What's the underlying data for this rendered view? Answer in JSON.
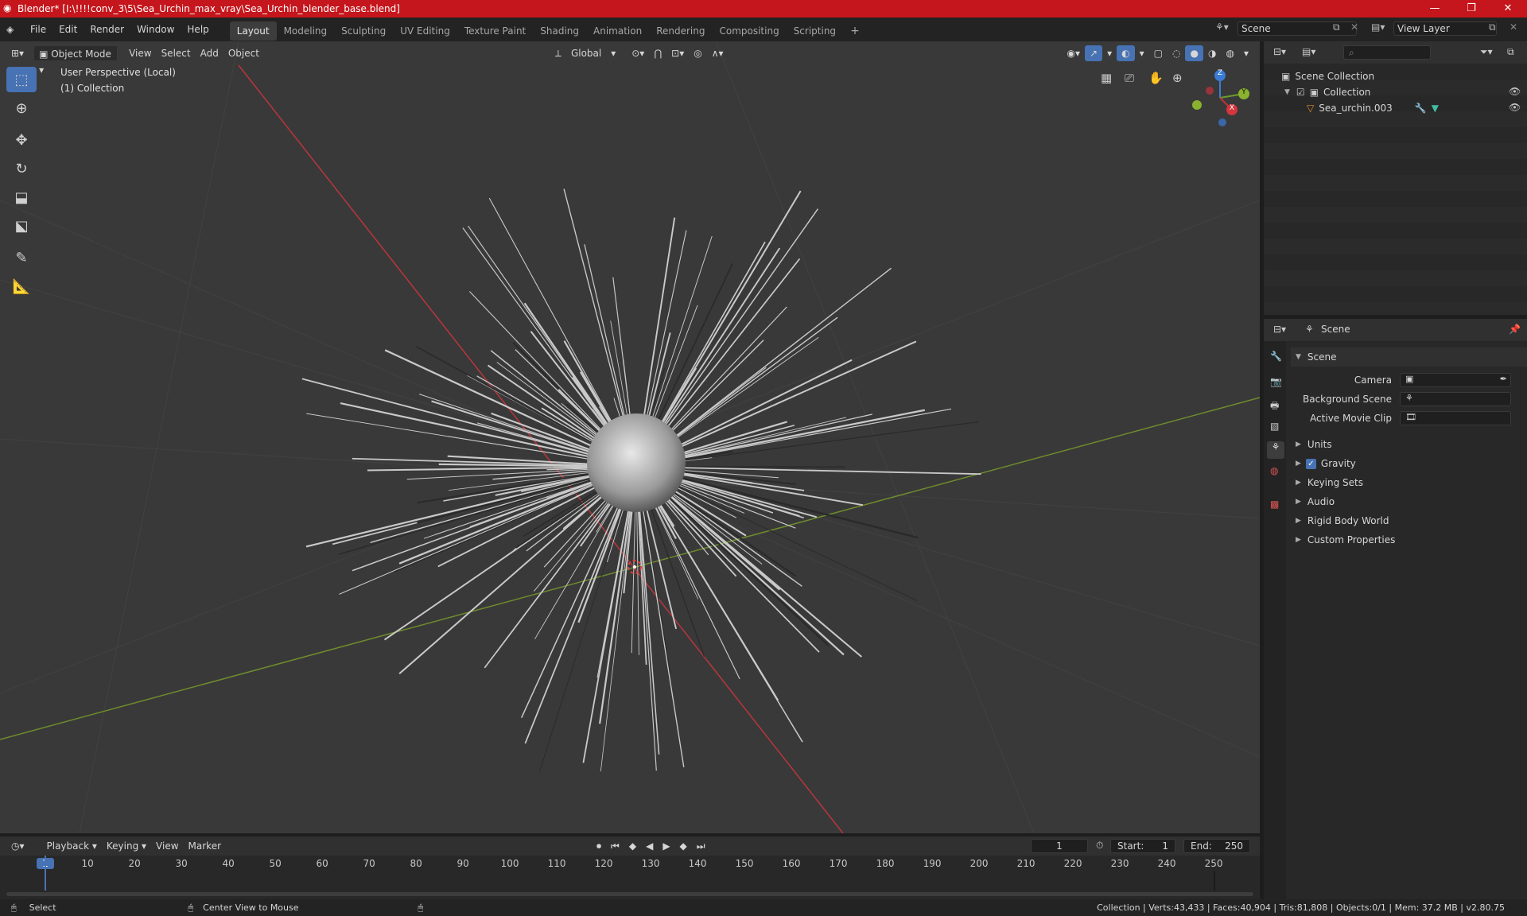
{
  "window": {
    "title": "Blender* [I:\\!!!!conv_3\\5\\Sea_Urchin_max_vray\\Sea_Urchin_blender_base.blend]",
    "min_icon": "minimize-icon",
    "max_icon": "restore-icon",
    "close_icon": "close-icon"
  },
  "menu": {
    "items": [
      "File",
      "Edit",
      "Render",
      "Window",
      "Help"
    ]
  },
  "workspaces": [
    "Layout",
    "Modeling",
    "Sculpting",
    "UV Editing",
    "Texture Paint",
    "Shading",
    "Animation",
    "Rendering",
    "Compositing",
    "Scripting"
  ],
  "active_workspace": "Layout",
  "scene_selector": "Scene",
  "view_layer": "View Layer",
  "viewport": {
    "mode": "Object Mode",
    "menus": [
      "View",
      "Select",
      "Add",
      "Object"
    ],
    "transform_orientation": "Global",
    "overlay_line1": "User Perspective (Local)",
    "overlay_line2": "(1) Collection",
    "gizmo_axes": {
      "z": "Z",
      "y": "Y",
      "x": "X"
    }
  },
  "outliner": {
    "root": "Scene Collection",
    "collection": "Collection",
    "object": "Sea_urchin.003",
    "search_placeholder": ""
  },
  "properties": {
    "header": "Scene",
    "panel": "Scene",
    "camera_label": "Camera",
    "background_scene_label": "Background Scene",
    "active_movie_clip_label": "Active Movie Clip",
    "sections": [
      "Units",
      "Gravity",
      "Keying Sets",
      "Audio",
      "Rigid Body World",
      "Custom Properties"
    ],
    "gravity_checked": true
  },
  "timeline": {
    "menus": [
      "Playback",
      "Keying",
      "View",
      "Marker"
    ],
    "current_frame": "1",
    "start_label": "Start:",
    "start_value": "1",
    "end_label": "End:",
    "end_value": "250",
    "ticks": [
      "1",
      "10",
      "20",
      "30",
      "40",
      "50",
      "60",
      "70",
      "80",
      "90",
      "100",
      "110",
      "120",
      "130",
      "140",
      "150",
      "160",
      "170",
      "180",
      "190",
      "200",
      "210",
      "220",
      "230",
      "240",
      "250"
    ]
  },
  "status": {
    "left_action": "Select",
    "mid_action": "Center View to Mouse",
    "stats": "Collection | Verts:43,433 | Faces:40,904 | Tris:81,808 | Objects:0/1 | Mem: 37.2 MB | v2.80.75"
  }
}
